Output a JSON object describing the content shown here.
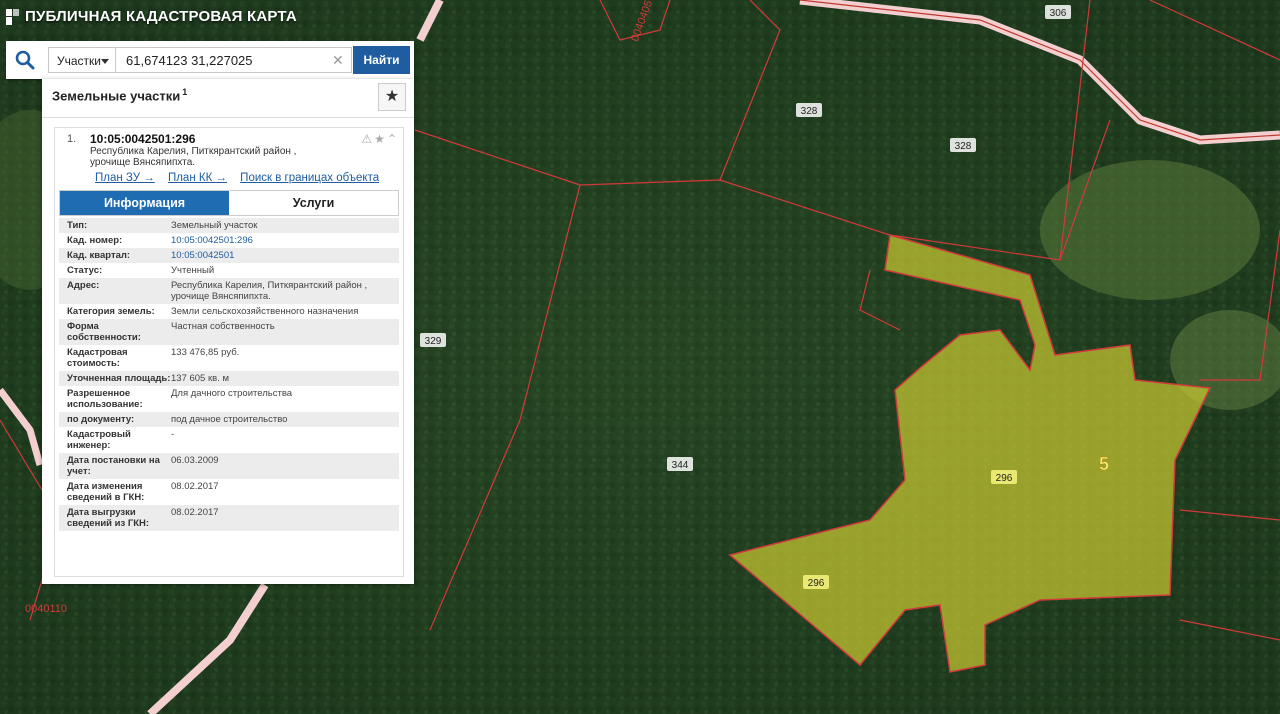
{
  "app": {
    "title": "ПУБЛИЧНАЯ КАДАСТРОВАЯ КАРТА"
  },
  "search": {
    "type_label": "Участки",
    "value": "61,674123 31,227025",
    "button_label": "Найти"
  },
  "panel": {
    "header": "Земельные участки",
    "count": "1",
    "item": {
      "number": "1.",
      "cadastral_id": "10:05:0042501:296",
      "address_line1": "Республика Карелия, Питкярантский район ,",
      "address_line2": "урочище Вянсяпипхта.",
      "links": [
        "План ЗУ →",
        "План КК →",
        "Поиск в границах объекта →"
      ],
      "tabs": [
        "Информация",
        "Услуги"
      ],
      "fields": [
        {
          "key": "Тип:",
          "value": "Земельный участок"
        },
        {
          "key": "Кад. номер:",
          "value": "10:05:0042501:296"
        },
        {
          "key": "Кад. квартал:",
          "value": "10:05:0042501"
        },
        {
          "key": "Статус:",
          "value": "Учтенный"
        },
        {
          "key": "Адрес:",
          "value": "Республика Карелия, Питкярантский район , урочище Вянсяпипхта."
        },
        {
          "key": "Категория земель:",
          "value": "Земли сельскохозяйственного назначения"
        },
        {
          "key": "Форма собственности:",
          "value": "Частная собственность"
        },
        {
          "key": "Кадастровая стоимость:",
          "value": "133 476,85 руб."
        },
        {
          "key": "Уточненная площадь:",
          "value": "137 605 кв. м"
        },
        {
          "key": "Разрешенное использование:",
          "value": "Для дачного строительства"
        },
        {
          "key": "по документу:",
          "value": "под дачное строительство"
        },
        {
          "key": "Кадастровый инженер:",
          "value": "-"
        },
        {
          "key": "Дата постановки на учет:",
          "value": "06.03.2009"
        },
        {
          "key": "Дата изменения сведений в ГКН:",
          "value": "08.02.2017"
        },
        {
          "key": "Дата выгрузки сведений из ГКН:",
          "value": "08.02.2017"
        }
      ]
    }
  },
  "map": {
    "labels": [
      "306",
      "328",
      "328",
      "329",
      "344",
      "296",
      "296",
      "5",
      "0040110",
      "0040405"
    ],
    "colors": {
      "forest": "#1f3a1e",
      "parcel_fill": "#c8c832",
      "boundary": "#d23a3a",
      "road": "#f2c8c8"
    }
  }
}
